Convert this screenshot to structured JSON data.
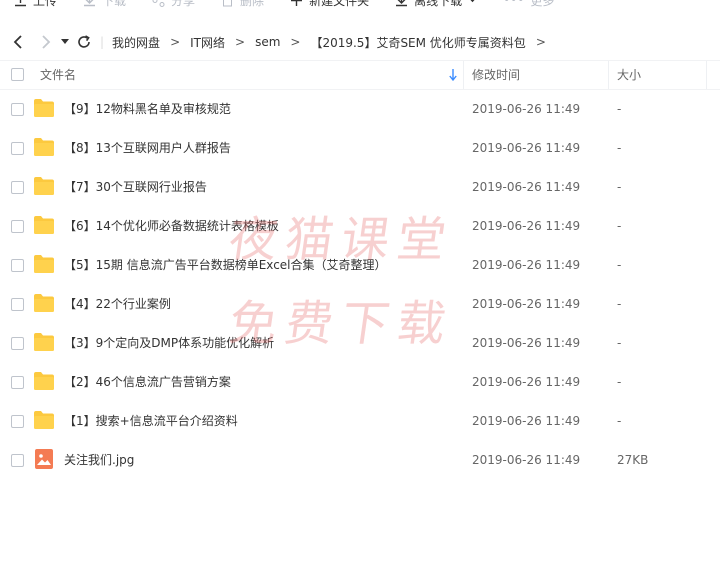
{
  "toolbar": {
    "upload": "上传",
    "download": "下载",
    "share": "分享",
    "delete": "删除",
    "new_folder": "新建文件夹",
    "offline_download": "离线下载",
    "more": "更多"
  },
  "breadcrumb": {
    "items": [
      "我的网盘",
      "IT网络",
      "sem",
      "【2019.5】艾奇SEM 优化师专属资料包"
    ],
    "sep": ">"
  },
  "table": {
    "col_name": "文件名",
    "col_time": "修改时间",
    "col_size": "大小"
  },
  "rows": [
    {
      "name": "【9】12物料黑名单及审核规范",
      "time": "2019-06-26 11:49",
      "size": "-",
      "icon": "folder-icon"
    },
    {
      "name": "【8】13个互联网用户人群报告",
      "time": "2019-06-26 11:49",
      "size": "-",
      "icon": "folder-icon"
    },
    {
      "name": "【7】30个互联网行业报告",
      "time": "2019-06-26 11:49",
      "size": "-",
      "icon": "folder-icon"
    },
    {
      "name": "【6】14个优化师必备数据统计表格模板",
      "time": "2019-06-26 11:49",
      "size": "-",
      "icon": "folder-icon"
    },
    {
      "name": "【5】15期 信息流广告平台数据榜单Excel合集（艾奇整理）",
      "time": "2019-06-26 11:49",
      "size": "-",
      "icon": "folder-icon"
    },
    {
      "name": "【4】22个行业案例",
      "time": "2019-06-26 11:49",
      "size": "-",
      "icon": "folder-icon"
    },
    {
      "name": "【3】9个定向及DMP体系功能优化解析",
      "time": "2019-06-26 11:49",
      "size": "-",
      "icon": "folder-icon"
    },
    {
      "name": "【2】46个信息流广告营销方案",
      "time": "2019-06-26 11:49",
      "size": "-",
      "icon": "folder-icon"
    },
    {
      "name": "【1】搜索+信息流平台介绍资料",
      "time": "2019-06-26 11:49",
      "size": "-",
      "icon": "folder-icon"
    },
    {
      "name": "关注我们.jpg",
      "time": "2019-06-26 11:49",
      "size": "27KB",
      "icon": "image-file-icon"
    }
  ],
  "watermark": {
    "line1": "夜猫课堂",
    "line2": "免费下载"
  },
  "colors": {
    "folder": "#fcc93f",
    "image_file": "#f47b53",
    "sort_arrow": "#3b8cff"
  }
}
